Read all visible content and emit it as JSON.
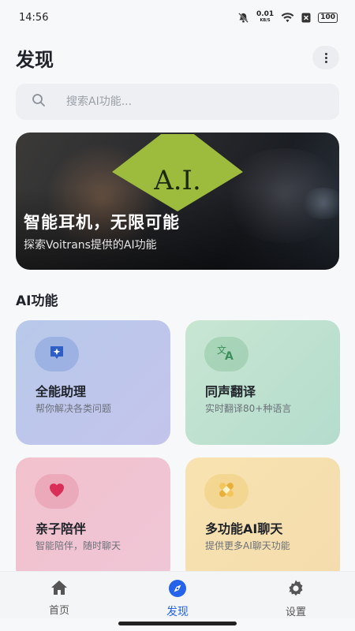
{
  "status_bar": {
    "time": "14:56",
    "net_speed_value": "0.01",
    "net_speed_unit": "KB/S",
    "battery": "100",
    "icons": [
      "bell-off-icon",
      "wifi-icon",
      "sim-x-icon",
      "battery-icon"
    ]
  },
  "header": {
    "title": "发现",
    "more_icon": "more-vertical-icon"
  },
  "search": {
    "placeholder": "搜索AI功能..."
  },
  "banner": {
    "sign_text": "A.I.",
    "title": "智能耳机，无限可能",
    "subtitle": "探索Voitrans提供的AI功能"
  },
  "section": {
    "title": "AI功能"
  },
  "cards": [
    {
      "title": "全能助理",
      "desc": "帮你解决各类问题",
      "icon": "sparkle-chat-icon",
      "color": "#2f5fc4"
    },
    {
      "title": "同声翻译",
      "desc": "实时翻译80+种语言",
      "icon": "translate-icon",
      "color": "#3c8f5a"
    },
    {
      "title": "亲子陪伴",
      "desc": "智能陪伴，随时聊天",
      "icon": "heart-icon",
      "color": "#d92e57"
    },
    {
      "title": "多功能AI聊天",
      "desc": "提供更多AI聊天功能",
      "icon": "bandage-icon",
      "color": "#e8b03a"
    }
  ],
  "bottom_nav": [
    {
      "label": "首页",
      "icon": "home-icon",
      "active": false
    },
    {
      "label": "发现",
      "icon": "compass-icon",
      "active": true
    },
    {
      "label": "设置",
      "icon": "gear-icon",
      "active": false
    }
  ],
  "colors": {
    "accent": "#2563eb",
    "background": "#f7f8fa"
  }
}
